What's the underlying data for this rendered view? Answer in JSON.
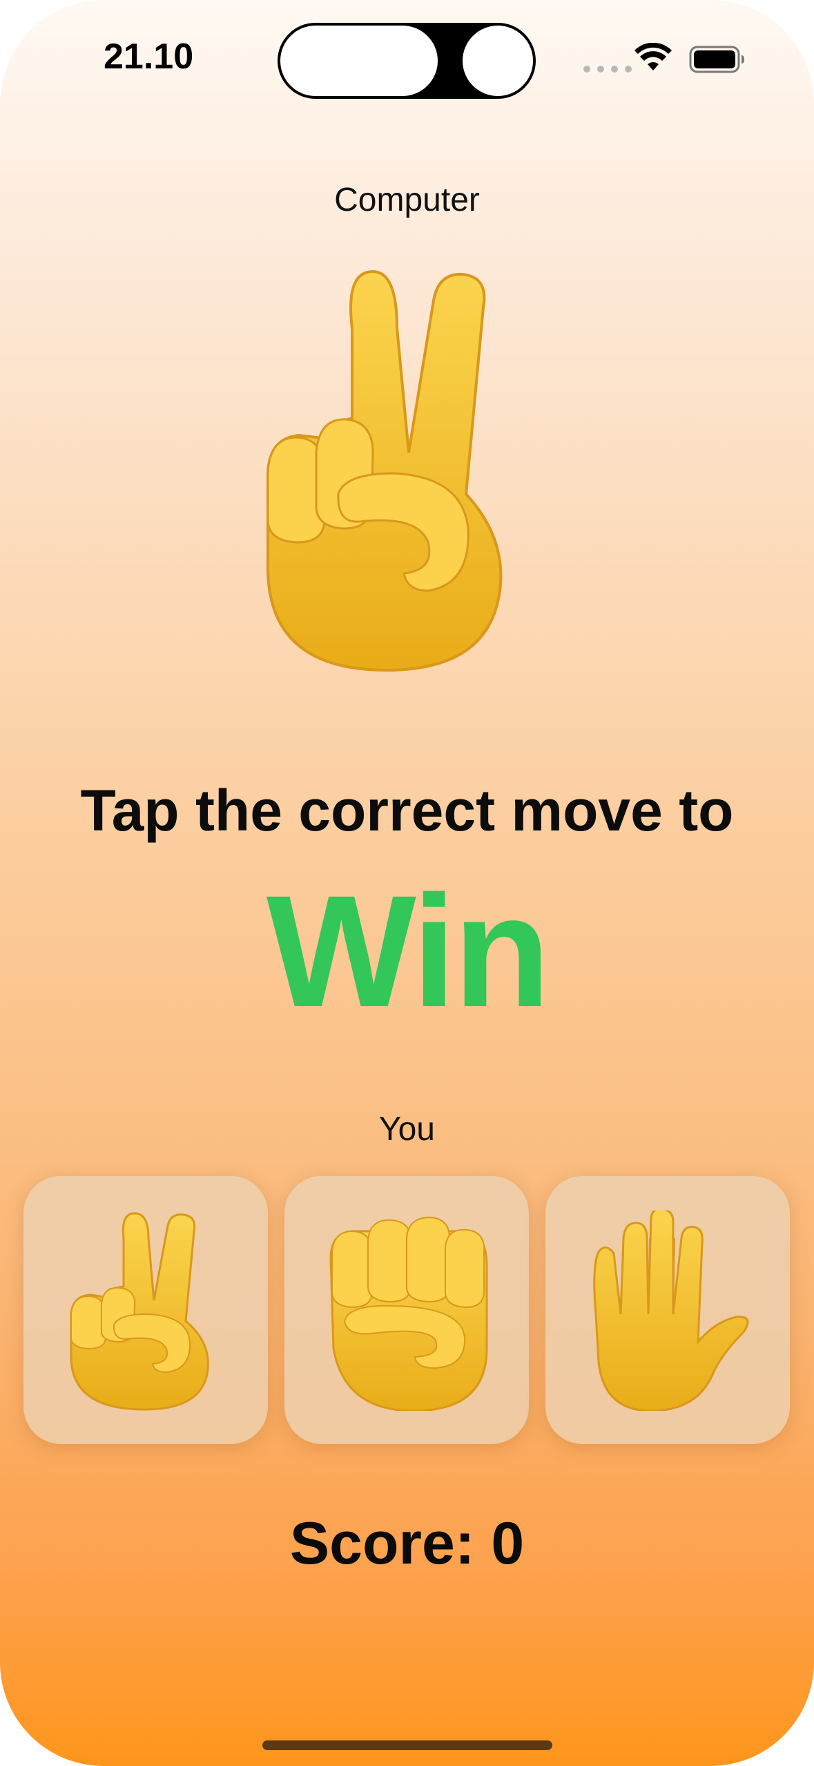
{
  "status_bar": {
    "time": "21.10",
    "icons": [
      "signal-dots-icon",
      "wifi-icon",
      "battery-icon"
    ]
  },
  "computer": {
    "label": "Computer",
    "move": "scissors",
    "move_icon": "victory-hand-icon"
  },
  "prompt": {
    "text": "Tap the correct move to",
    "goal": "Win",
    "goal_color": "#33c659"
  },
  "player": {
    "label": "You",
    "choices": [
      {
        "move": "scissors",
        "icon": "victory-hand-icon"
      },
      {
        "move": "rock",
        "icon": "raised-fist-icon"
      },
      {
        "move": "paper",
        "icon": "raised-hand-icon"
      }
    ]
  },
  "score": {
    "text": "Score: 0"
  },
  "colors": {
    "background_top": "#fff9f3",
    "background_bottom": "#fe961c",
    "emoji_yellow": "#f7c531"
  }
}
